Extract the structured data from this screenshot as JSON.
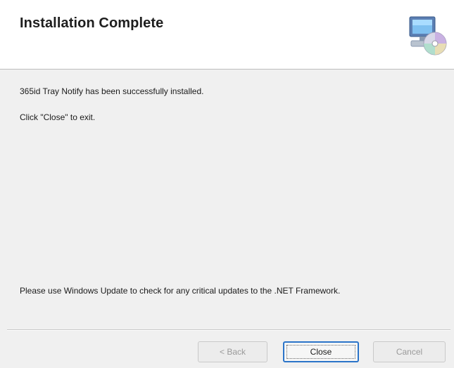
{
  "header": {
    "title": "Installation Complete",
    "icon": "computer-with-cd-icon"
  },
  "body": {
    "line1": "365id Tray Notify has been successfully installed.",
    "line2": "Click \"Close\" to exit.",
    "line3": "Please use Windows Update to check for any critical updates to the .NET Framework."
  },
  "buttons": {
    "back_label": "< Back",
    "close_label": "Close",
    "cancel_label": "Cancel"
  },
  "colors": {
    "focus_border": "#2b74c9",
    "dialog_background": "#f0f0f0",
    "header_background": "#ffffff"
  }
}
